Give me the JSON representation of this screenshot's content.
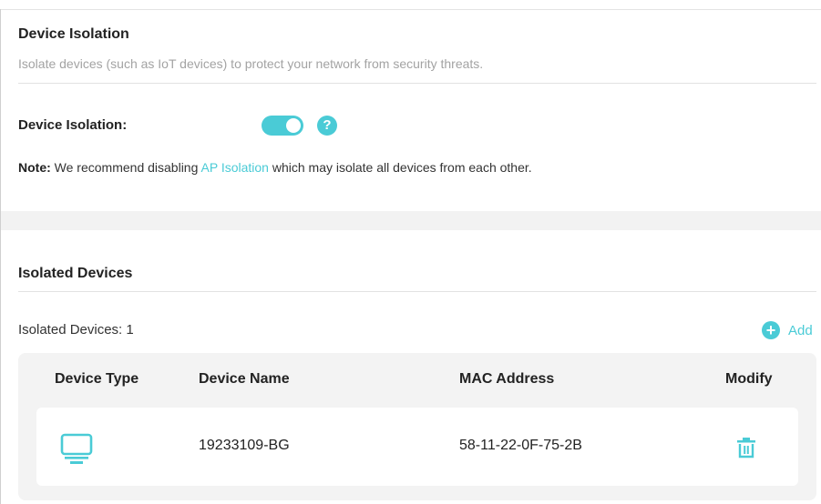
{
  "isolation_section": {
    "title": "Device Isolation",
    "description": "Isolate devices (such as IoT devices) to protect your network from security threats.",
    "toggle_label": "Device Isolation:",
    "toggle_state": "on",
    "help_glyph": "?",
    "note_prefix": "Note:",
    "note_before_link": " We recommend disabling ",
    "note_link": "AP Isolation",
    "note_after_link": " which may isolate all devices from each other."
  },
  "devices_section": {
    "title": "Isolated Devices",
    "count_label": "Isolated Devices: 1",
    "add_icon": "+",
    "add_label": "Add",
    "columns": [
      "Device Type",
      "Device Name",
      "MAC Address",
      "Modify"
    ],
    "rows": [
      {
        "device_type_icon": "monitor-icon",
        "device_name": "19233109-BG",
        "mac_address": "58-11-22-0F-75-2B",
        "modify_icon": "trash-icon"
      }
    ]
  },
  "colors": {
    "accent": "#4acbd6",
    "title_text": "#222222",
    "muted_text": "#a3a3a3",
    "panel_bg": "#f3f3f3"
  }
}
